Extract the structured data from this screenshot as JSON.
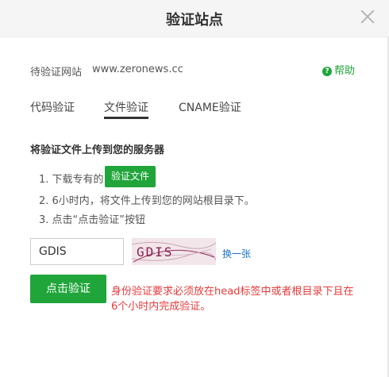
{
  "dialog": {
    "title": "验证站点",
    "site_label": "待验证网站",
    "site_value": "www.zeronews.cc",
    "help_label": "帮助",
    "help_icon_glyph": "?"
  },
  "tabs": [
    {
      "label": "代码验证",
      "active": false
    },
    {
      "label": "文件验证",
      "active": true
    },
    {
      "label": "CNAME验证",
      "active": false
    }
  ],
  "content": {
    "section_title": "将验证文件上传到您的服务器",
    "step1_prefix": "1. 下载专有的",
    "download_button": "验证文件",
    "step2": "2. 6小时内，将文件上传到您的网站根目录下。",
    "step3": "3. 点击“点击验证”按钮"
  },
  "captcha": {
    "input_value": "GDIS",
    "image_text": "GDIS",
    "refresh_label": "换一张"
  },
  "submit": {
    "button_label": "点击验证",
    "warning_line1": "身份验证要求必须放在head标签中或者根目录下且在",
    "warning_line2": "6个小时内完成验证。"
  },
  "colors": {
    "accent_green": "#20a53a",
    "warning_red": "#e63b3b",
    "link_blue": "#1a73c9"
  }
}
